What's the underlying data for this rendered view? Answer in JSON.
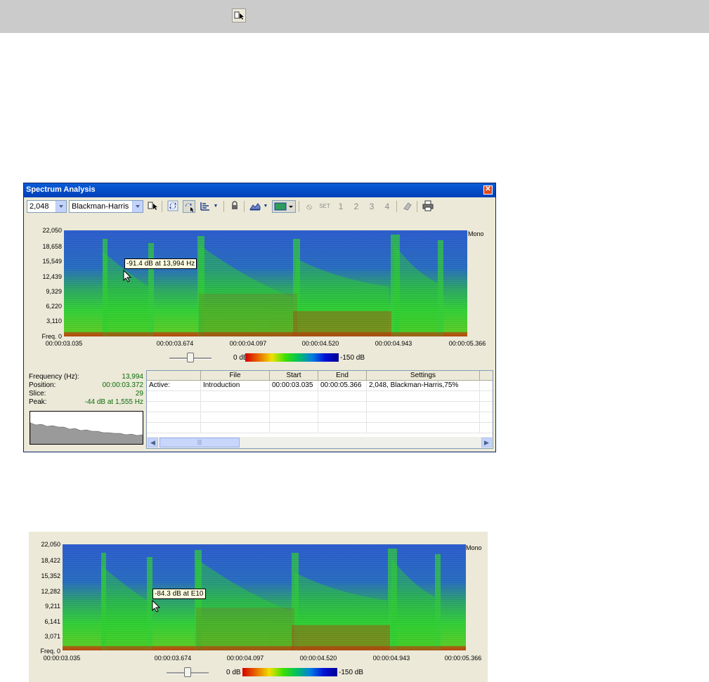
{
  "top_toolbar": {
    "icon": "select-region-icon"
  },
  "window": {
    "title": "Spectrum Analysis",
    "close_icon": "close-icon",
    "toolbar": {
      "fft_size": "2,048",
      "window_type": "Blackman-Harris",
      "set_label": "SET",
      "marker_1": "1",
      "marker_2": "2",
      "marker_3": "3",
      "marker_4": "4"
    },
    "spectrogram": {
      "channel": "Mono",
      "y_ticks": [
        "22,050",
        "18,658",
        "15,549",
        "12,439",
        "9,329",
        "6,220",
        "3,110",
        "Freq. 0"
      ],
      "x_ticks": [
        "00:00:03.035",
        "00:00:03.674",
        "00:00:04.097",
        "00:00:04.520",
        "00:00:04.943",
        "00:00:05.366"
      ],
      "tooltip": "-91.4 dB at 13,994 Hz",
      "scale_min": "0 dB",
      "scale_max": "-150 dB"
    },
    "info": {
      "frequency_label": "Frequency (Hz):",
      "frequency_value": "13,994",
      "position_label": "Position:",
      "position_value": "00:00:03.372",
      "slice_label": "Slice:",
      "slice_value": "29",
      "peak_label": "Peak:",
      "peak_value": "-44 dB at 1,555 Hz"
    },
    "table": {
      "headers": [
        "",
        "File",
        "Start",
        "End",
        "Settings"
      ],
      "rows": [
        [
          "Active:",
          "Introduction",
          "00:00:03.035",
          "00:00:05.366",
          "2,048, Blackman-Harris,75%"
        ]
      ]
    }
  },
  "second_panel": {
    "channel": "Mono",
    "y_ticks": [
      "22,050",
      "18,422",
      "15,352",
      "12,282",
      "9,211",
      "6,141",
      "3,071",
      "Freq. 0"
    ],
    "x_ticks": [
      "00:00:03.035",
      "00:00:03.674",
      "00:00:04.097",
      "00:00:04.520",
      "00:00:04.943",
      "00:00:05.366"
    ],
    "tooltip": "-84.3 dB at E10",
    "scale_min": "0 dB",
    "scale_max": "-150 dB"
  },
  "colors": {
    "spectrum_low": "#1d3fcf",
    "spectrum_mid": "#2fd22f",
    "spectrum_high": "#c0360a",
    "titlebar": "#0a5bd8"
  }
}
